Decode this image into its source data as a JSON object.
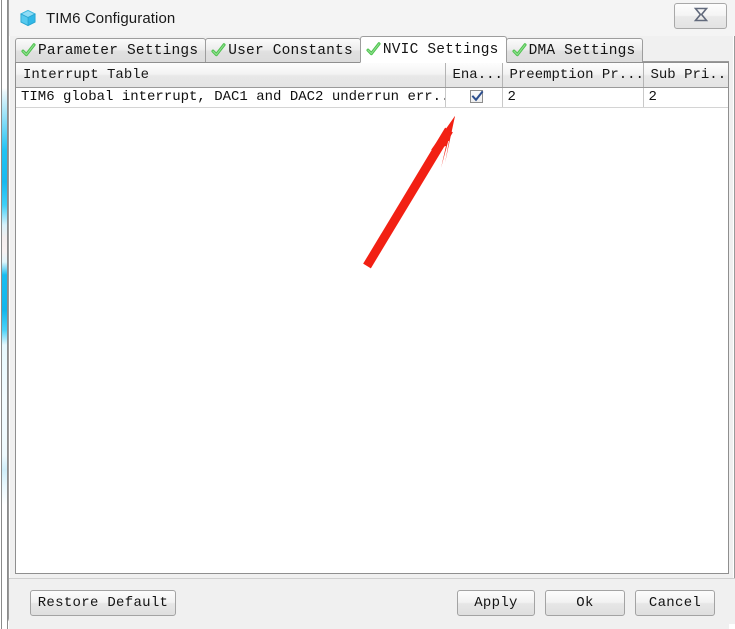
{
  "window": {
    "title": "TIM6 Configuration",
    "icon": "cube-icon",
    "close_label": "✖",
    "close_icon": "close-icon"
  },
  "tabs": [
    {
      "label": "Parameter Settings",
      "icon": "green-check-icon",
      "active": false
    },
    {
      "label": "User Constants",
      "icon": "green-check-icon",
      "active": false
    },
    {
      "label": "NVIC Settings",
      "icon": "green-check-icon",
      "active": true
    },
    {
      "label": "DMA Settings",
      "icon": "green-check-icon",
      "active": false
    }
  ],
  "table": {
    "columns": [
      "Interrupt Table",
      "Ena...",
      "Preemption Pr...",
      "Sub Pri..."
    ],
    "rows": [
      {
        "interrupt": "TIM6 global interrupt, DAC1 and DAC2 underrun err...",
        "enabled": true,
        "enabled_icon": "checkbox-checked-icon",
        "preemption_priority": "2",
        "sub_priority": "2"
      }
    ]
  },
  "buttons": {
    "restore_default": "Restore Default",
    "apply": "Apply",
    "ok": "Ok",
    "cancel": "Cancel"
  },
  "annotation": {
    "type": "red-arrow",
    "points_to": "enable-checkbox",
    "color": "#f22013"
  },
  "colors": {
    "accent_cyan": "#18bdf0",
    "check_green": "#49c249",
    "checkbox_blue": "#2d4f8e",
    "window_bg": "#f0f0f0",
    "panel_bg": "#ffffff",
    "arrow_red": "#f22013"
  }
}
